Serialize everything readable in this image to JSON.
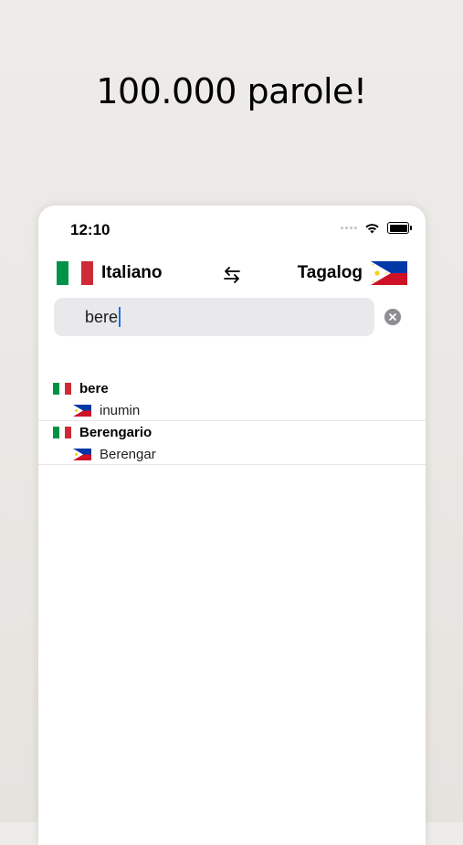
{
  "headline": "100.000 parole!",
  "status": {
    "time": "12:10"
  },
  "languages": {
    "source": {
      "name": "Italiano",
      "flag": "italy-flag-icon"
    },
    "target": {
      "name": "Tagalog",
      "flag": "philippines-flag-icon"
    },
    "swap_icon": "swap-arrows-icon"
  },
  "search": {
    "value": "bere",
    "clear_icon": "clear-circle-icon"
  },
  "results": [
    {
      "word": "bere",
      "translation": "inumin"
    },
    {
      "word": "Berengario",
      "translation": "Berengar"
    }
  ],
  "colors": {
    "italy_green": "#009246",
    "italy_white": "#ffffff",
    "italy_red": "#ce2b37",
    "ph_blue": "#0038a8",
    "ph_red": "#ce1126",
    "ph_yellow": "#fcd116",
    "caret": "#1a73e8"
  }
}
